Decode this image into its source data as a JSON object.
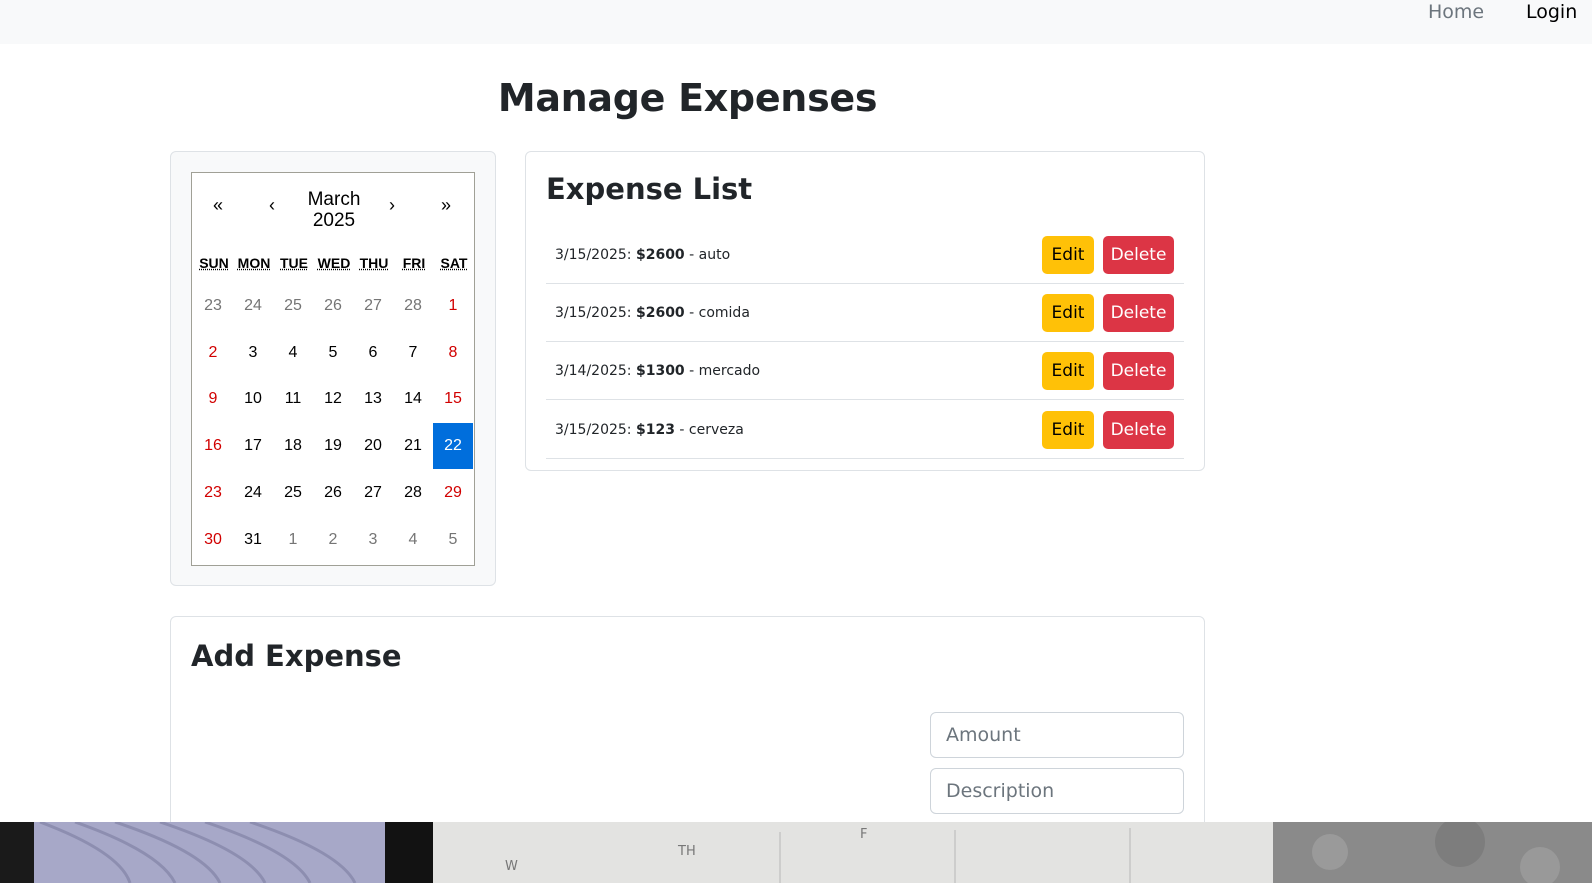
{
  "nav": {
    "home": "Home",
    "login": "Login"
  },
  "page_title": "Manage Expenses",
  "calendar": {
    "prev2": "«",
    "prev": "‹",
    "next": "›",
    "next2": "»",
    "month": "March",
    "year": "2025",
    "weekdays": [
      "SUN",
      "MON",
      "TUE",
      "WED",
      "THU",
      "FRI",
      "SAT"
    ],
    "weeks": [
      [
        "23",
        "24",
        "25",
        "26",
        "27",
        "28",
        "1"
      ],
      [
        "2",
        "3",
        "4",
        "5",
        "6",
        "7",
        "8"
      ],
      [
        "9",
        "10",
        "11",
        "12",
        "13",
        "14",
        "15"
      ],
      [
        "16",
        "17",
        "18",
        "19",
        "20",
        "21",
        "22"
      ],
      [
        "23",
        "24",
        "25",
        "26",
        "27",
        "28",
        "29"
      ],
      [
        "30",
        "31",
        "1",
        "2",
        "3",
        "4",
        "5"
      ]
    ],
    "selected": "22"
  },
  "expense_list": {
    "title": "Expense List",
    "edit_label": "Edit",
    "delete_label": "Delete",
    "items": [
      {
        "date": "3/15/2025:",
        "amount": "$2600",
        "description": "- auto"
      },
      {
        "date": "3/15/2025:",
        "amount": "$2600",
        "description": "- comida"
      },
      {
        "date": "3/14/2025:",
        "amount": "$1300",
        "description": "- mercado"
      },
      {
        "date": "3/15/2025:",
        "amount": "$123",
        "description": "- cerveza"
      }
    ]
  },
  "add_expense": {
    "title": "Add Expense",
    "amount_placeholder": "Amount",
    "description_placeholder": "Description"
  },
  "background": {
    "text": [
      "W",
      "TH",
      "F"
    ]
  }
}
